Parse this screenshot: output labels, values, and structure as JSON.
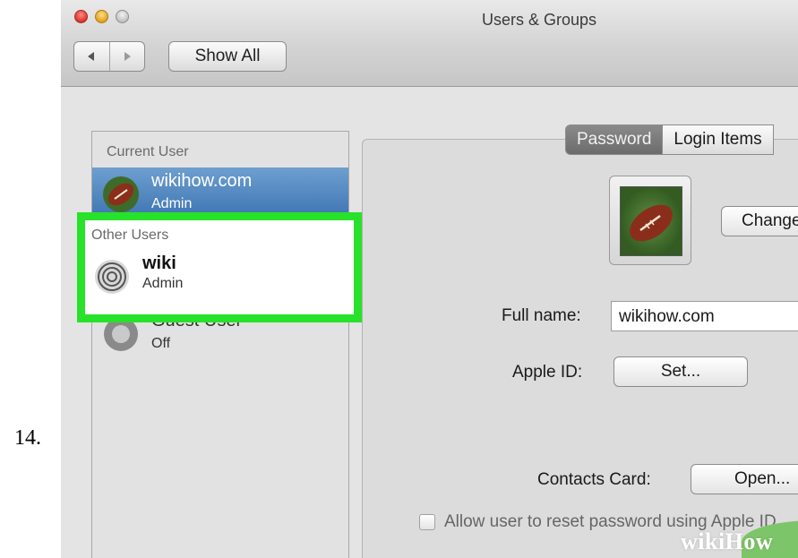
{
  "step_number": "14.",
  "window": {
    "title": "Users & Groups",
    "show_all_label": "Show All"
  },
  "sidebar": {
    "current_user_header": "Current User",
    "current_user": {
      "name": "wikihow.com",
      "role": "Admin"
    },
    "other_users_header": "Other Users",
    "other_users": [
      {
        "name": "wiki",
        "role": "Admin"
      },
      {
        "name": "Guest User",
        "role": "Off"
      }
    ]
  },
  "detail": {
    "tabs": [
      "Password",
      "Login Items"
    ],
    "change_label": "Change...",
    "full_name_label": "Full name:",
    "full_name_value": "wikihow.com",
    "apple_id_label": "Apple ID:",
    "set_label": "Set...",
    "contacts_card_label": "Contacts Card:",
    "open_label": "Open...",
    "allow_reset_label": "Allow user to reset password using Apple ID"
  },
  "watermark": "wikiHow",
  "colors": {
    "highlight": "#28e12a",
    "selection": "#3a72b0",
    "watermark_green": "#7dc569"
  }
}
